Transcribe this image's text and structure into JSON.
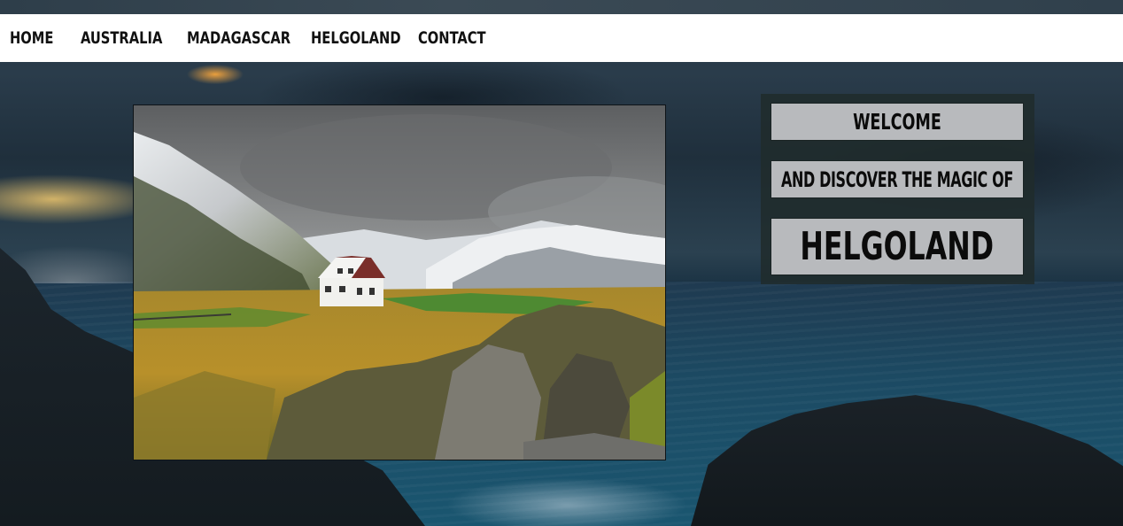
{
  "nav": {
    "items": [
      {
        "label": "HOME"
      },
      {
        "label": "AUSTRALIA"
      },
      {
        "label": "MADAGASCAR"
      },
      {
        "label": "HELGOLAND"
      },
      {
        "label": "CONTACT"
      }
    ]
  },
  "hero": {
    "welcome": "WELCOME",
    "subtitle": "AND DISCOVER THE MAGIC OF",
    "destination": "HELGOLAND"
  },
  "colors": {
    "nav_background": "#ffffff",
    "nav_text": "#111111",
    "panel_background": "#202c2c",
    "panel_box": "#b8babd"
  }
}
